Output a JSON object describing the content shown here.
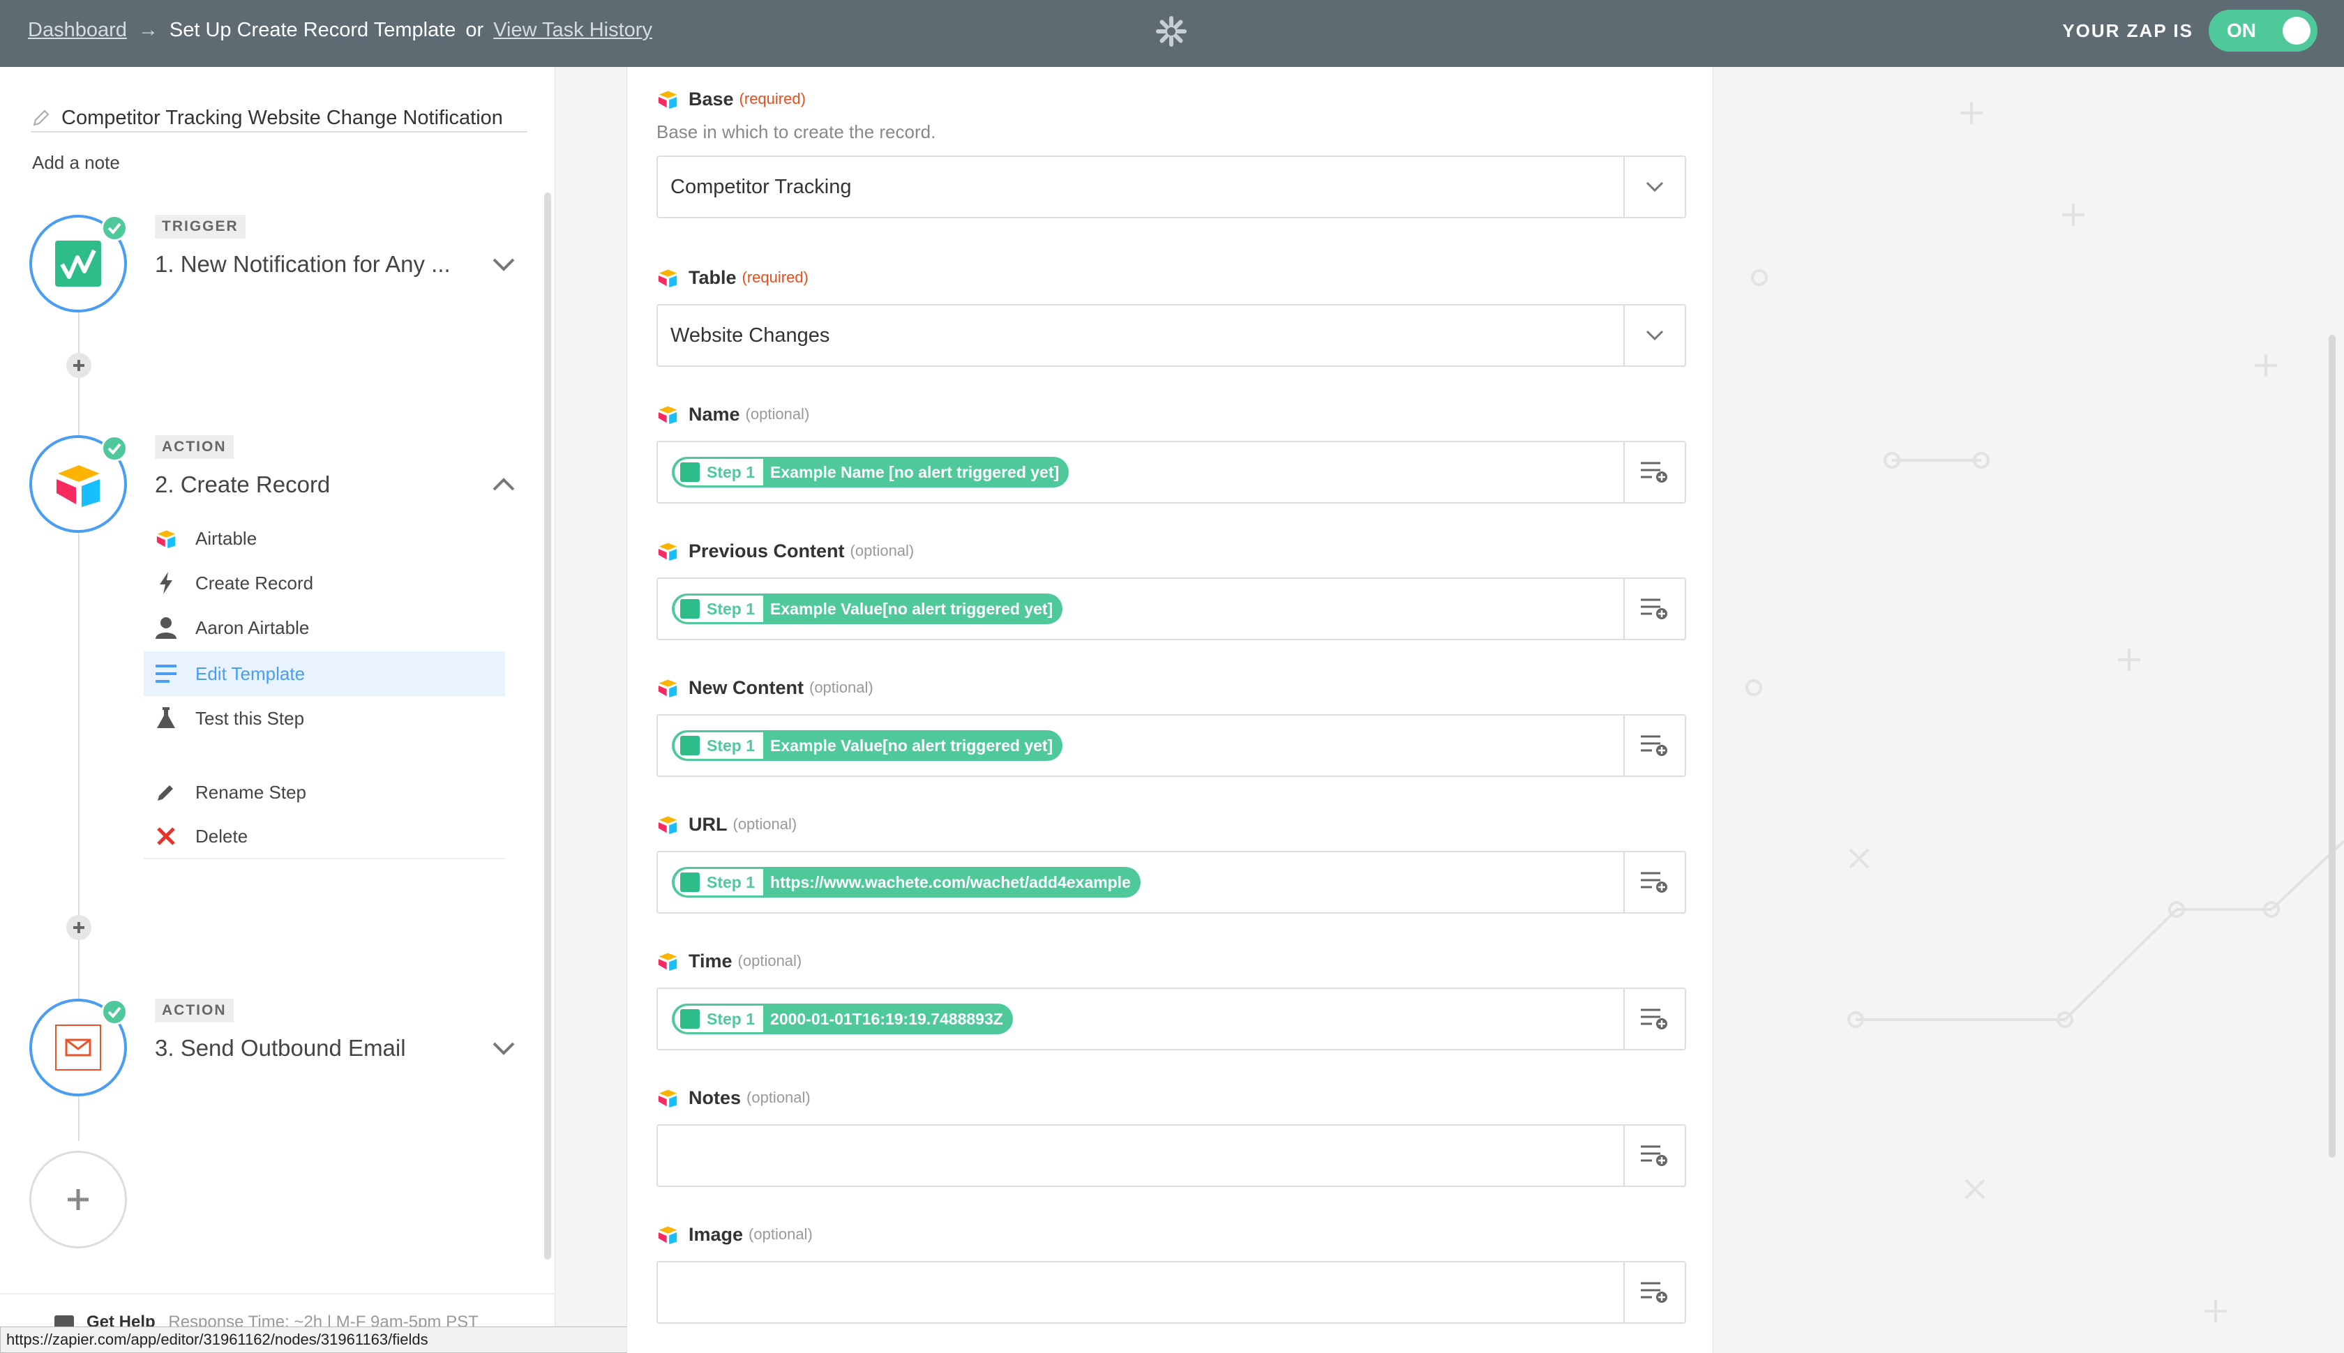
{
  "topbar": {
    "breadcrumb_dashboard": "Dashboard",
    "breadcrumb_arrow": "→",
    "breadcrumb_current": "Set Up Create Record Template",
    "breadcrumb_or": "or",
    "breadcrumb_history": "View Task History",
    "zap_label": "YOUR ZAP IS",
    "toggle_state": "ON",
    "bar_color": "#5e6b72",
    "toggle_color": "#4fc99a"
  },
  "sidebar": {
    "zap_name": "Competitor Tracking Website Change Notification",
    "add_note": "Add a note",
    "steps": [
      {
        "badge": "TRIGGER",
        "title": "1. New Notification for Any ...",
        "icon": "wachete-icon",
        "expanded": false
      },
      {
        "badge": "ACTION",
        "title": "2. Create Record",
        "icon": "airtable-icon",
        "expanded": true
      },
      {
        "badge": "ACTION",
        "title": "3. Send Outbound Email",
        "icon": "email-icon",
        "expanded": false
      }
    ],
    "submenu": [
      {
        "label": "Airtable",
        "icon": "airtable-icon"
      },
      {
        "label": "Create Record",
        "icon": "lightning-icon"
      },
      {
        "label": "Aaron Airtable",
        "icon": "person-icon"
      },
      {
        "label": "Edit Template",
        "icon": "list-icon",
        "active": true
      },
      {
        "label": "Test this Step",
        "icon": "flask-icon"
      }
    ],
    "rename_label": "Rename Step",
    "delete_label": "Delete",
    "help_label": "Get Help",
    "help_sub": "Response Time: ~2h | M-F 9am-5pm PST",
    "status_url": "https://zapier.com/app/editor/31961162/nodes/31961163/fields",
    "accent_color": "#499df3"
  },
  "form": {
    "base": {
      "label": "Base",
      "tag": "(required)",
      "help": "Base in which to create the record.",
      "value": "Competitor Tracking"
    },
    "table": {
      "label": "Table",
      "tag": "(required)",
      "value": "Website Changes"
    },
    "fields": [
      {
        "label": "Name",
        "tag": "(optional)",
        "step": "Step 1",
        "value": "Example Name [no alert triggered yet]"
      },
      {
        "label": "Previous Content",
        "tag": "(optional)",
        "step": "Step 1",
        "value": "Example Value[no alert triggered yet]"
      },
      {
        "label": "New Content",
        "tag": "(optional)",
        "step": "Step 1",
        "value": "Example Value[no alert triggered yet]"
      },
      {
        "label": "URL",
        "tag": "(optional)",
        "step": "Step 1",
        "value": "https://www.wachete.com/wachet/add4example"
      },
      {
        "label": "Time",
        "tag": "(optional)",
        "step": "Step 1",
        "value": "2000-01-01T16:19:19.7488893Z"
      },
      {
        "label": "Notes",
        "tag": "(optional)",
        "step": "",
        "value": ""
      },
      {
        "label": "Image",
        "tag": "(optional)",
        "step": "",
        "value": ""
      }
    ],
    "pill_color": "#4fc99a",
    "required_color": "#e84d1c"
  }
}
